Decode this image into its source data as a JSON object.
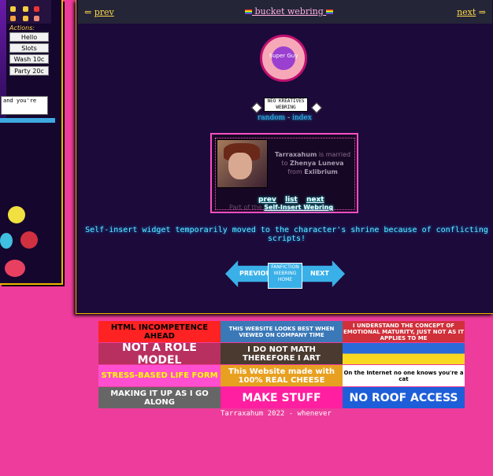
{
  "sidebar": {
    "actions_label": "Actions:",
    "buttons": [
      "Hello",
      "Slots",
      "Wash 10c",
      "Party 20c"
    ],
    "chat_text": "and you're"
  },
  "webring": {
    "prev_arrow": "⇐",
    "prev_label": "prev",
    "next_label": "next",
    "next_arrow": "⇒",
    "title": "bucket webring"
  },
  "seal_text": "Super Guy",
  "badge_text": "NEO KREATIVES WEBRING",
  "random_label": "random",
  "dash": "-",
  "index_label": "index",
  "widget": {
    "married_name": "Tarraxahum",
    "married_mid": "is married to",
    "spouse": "Zhenya Luneva",
    "from": "from",
    "source": "Exlibrium",
    "nav": [
      "prev",
      "list",
      "next"
    ],
    "part_of": "Part of the",
    "ring_name": "Self-Insert Webring"
  },
  "notice": "Self-insert widget temporarily moved to the character's shrine because of conflicting scripts!",
  "fanfic": {
    "prev": "PREVIOUS",
    "home": "FANFICTION WEBRING HOME",
    "next": "NEXT"
  },
  "buttons88": [
    {
      "text": "HTML INCOMPETENCE AHEAD",
      "bg": "#ff2222",
      "fg": "#000000"
    },
    {
      "text": "THIS WEBSITE LOOKS BEST WHEN VIEWED ON COMPANY TIME",
      "bg": "#3a78b8",
      "fg": "#ffffff"
    },
    {
      "text": "I UNDERSTAND THE CONCEPT OF EMOTIONAL MATURITY, JUST NOT AS IT APPLIES TO ME",
      "bg": "#d0303a",
      "fg": "#ffffff"
    },
    {
      "text": "NOT A ROLE MODEL",
      "bg": "#b83060",
      "fg": "#ffffff"
    },
    {
      "text": "I DO NOT MATH THEREFORE I ART",
      "bg": "#4a3a30",
      "fg": "#ffffff"
    },
    {
      "text": "",
      "bg": "#2a6ad8",
      "fg": "#ffffff"
    },
    {
      "text": "STRESS-BASED LIFE FORM",
      "bg": "#ff4fd0",
      "fg": "#ffff00"
    },
    {
      "text": "This Website made with 100% REAL CHEESE",
      "bg": "#e8a020",
      "fg": "#ffffff"
    },
    {
      "text": "On the Internet no one knows you're a cat",
      "bg": "#ffffff",
      "fg": "#000000"
    },
    {
      "text": "MAKING IT UP AS I GO ALONG",
      "bg": "#666666",
      "fg": "#ffffff"
    },
    {
      "text": "MAKE STUFF",
      "bg": "#ff1fa0",
      "fg": "#ffffff"
    },
    {
      "text": "NO ROOF ACCESS",
      "bg": "#1e5ed8",
      "fg": "#ffffff"
    }
  ],
  "footer": "Tarraxahum 2022 - whenever"
}
